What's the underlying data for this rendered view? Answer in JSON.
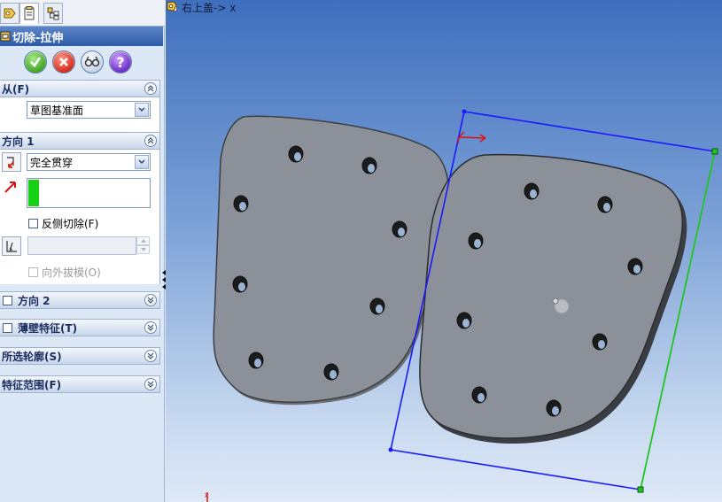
{
  "tabs": [
    {
      "name": "feature-manager-tab",
      "active": false
    },
    {
      "name": "property-manager-tab",
      "active": true
    },
    {
      "name": "configuration-manager-tab",
      "active": false
    }
  ],
  "panel": {
    "title": "切除-拉伸",
    "buttons": {
      "ok": "ok",
      "cancel": "cancel",
      "preview": "detailed-preview",
      "help": "?"
    },
    "from_group": {
      "label": "从(F)",
      "start_condition": "草图基准面"
    },
    "direction1": {
      "label": "方向 1",
      "end_condition": "完全贯穿",
      "flip_side_label": "反侧切除(F)",
      "draft_label": "向外拔模(O)"
    },
    "direction2": {
      "label": "方向 2"
    },
    "thin_feature": {
      "label": "薄壁特征(T)"
    },
    "selected_contours": {
      "label": "所选轮廓(S)"
    },
    "feature_scope": {
      "label": "特征范围(F)"
    }
  },
  "viewport": {
    "breadcrumb": "右上盖-> x",
    "triad_label": "x"
  },
  "colors": {
    "panel_title": "#2d5aa6",
    "viewport_top": "#3f6fbd",
    "part_face": "#8c9199",
    "sketch_blue": "#1a1aff",
    "sketch_green": "#22c422",
    "direction_swatch": "#17d117"
  }
}
